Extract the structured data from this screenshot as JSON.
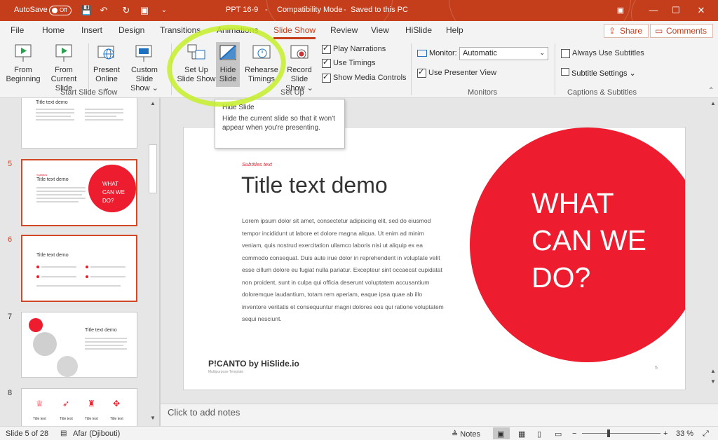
{
  "titlebar": {
    "autosave_label": "AutoSave",
    "autosave_state": "Off",
    "filename": "PPT 16-9",
    "mode": "Compatibility Mode",
    "saved_status": "Saved to this PC"
  },
  "tabs": [
    "File",
    "Home",
    "Insert",
    "Design",
    "Transitions",
    "Animations",
    "Slide Show",
    "Review",
    "View",
    "HiSlide",
    "Help"
  ],
  "active_tab": "Slide Show",
  "header_buttons": {
    "share": "Share",
    "comments": "Comments"
  },
  "ribbon": {
    "start_group": {
      "label": "Start Slide Show",
      "from_beginning": "From\nBeginning",
      "from_current": "From\nCurrent Slide",
      "present_online": "Present\nOnline ⌄",
      "custom_show": "Custom Slide\nShow ⌄"
    },
    "setup_group": {
      "label": "Set Up",
      "set_up": "Set Up\nSlide Show",
      "hide": "Hide\nSlide",
      "rehearse": "Rehearse\nTimings",
      "record": "Record Slide\nShow ⌄",
      "play_narrations": "Play Narrations",
      "use_timings": "Use Timings",
      "show_media": "Show Media Controls"
    },
    "monitors_group": {
      "label": "Monitors",
      "monitor_label": "Monitor:",
      "monitor_value": "Automatic",
      "presenter_view": "Use Presenter View"
    },
    "captions_group": {
      "label": "Captions & Subtitles",
      "always_subtitles": "Always Use Subtitles",
      "subtitle_settings": "Subtitle Settings ⌄"
    }
  },
  "tooltip": {
    "title": "Hide Slide",
    "body": "Hide the current slide so that it won't appear when you're presenting."
  },
  "thumbnails": {
    "top_title": "Title text demo",
    "items": [
      {
        "num": "5",
        "title": "Title text demo",
        "circle": "WHAT\nCAN WE\nDO?"
      },
      {
        "num": "6",
        "title": "Title text demo"
      },
      {
        "num": "7",
        "title": "Title text demo"
      },
      {
        "num": "8",
        "labels": [
          "Title text",
          "Title text",
          "Title text",
          "Title text"
        ]
      }
    ]
  },
  "slide": {
    "subtitle": "Subtitles text",
    "title": "Title text demo",
    "body": "Lorem ipsum dolor sit amet, consectetur adipiscing elit, sed do eiusmod tempor incididunt ut labore et dolore magna aliqua. Ut enim ad minim veniam, quis nostrud exercitation ullamco laboris nisi ut aliquip ex ea commodo consequat. Duis aute irue dolor in reprehenderit in voluptate velit esse cillum dolore eu fugiat nulla pariatur. Excepteur sint occaecat cupidatat non proident, sunt in culpa qui officia deserunt voluptatem accusantium doloremque laudantium, totam rem aperiam, eaque ipsa quae ab illo inventore veritatis et consequuntur magni dolores eos qui ratione voluptatem sequi nesciunt.",
    "circle_text": "WHAT\nCAN WE\nDO?",
    "brand": "P!CANTO by HiSlide.io",
    "brand_sub": "Multipurpose Template",
    "page_number": "5",
    "accent_color": "#ed1c2e"
  },
  "notes_placeholder": "Click to add notes",
  "status": {
    "slide_counter": "Slide 5 of 28",
    "language": "Afar (Djibouti)",
    "notes_label": "Notes",
    "zoom": "33 %"
  }
}
